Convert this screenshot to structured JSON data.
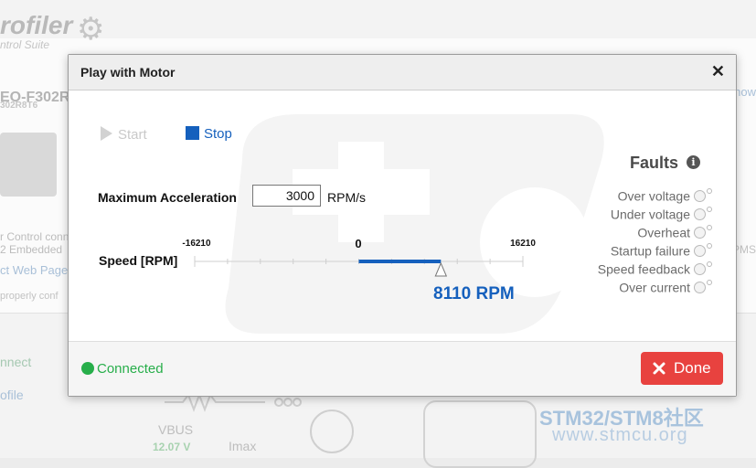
{
  "background": {
    "logo_main": "rofiler",
    "logo_sub": "ntrol Suite",
    "board_name": "EO-F302R",
    "board_part": "302R8T6",
    "text_line1": "r Control conn",
    "text_line2": "2 Embedded",
    "link_text": "ct Web Page",
    "text_line3": "properly conf",
    "right_link": "how",
    "right_text": "PMS",
    "nav_connect": "nnect",
    "nav_profile": "ofile",
    "vbus_label": "VBUS",
    "vbus_value": "12.07 V",
    "imax_label": "Imax",
    "watermark_line1": "STM32/STM8社区",
    "watermark_line2": "www.stmcu.org"
  },
  "dialog": {
    "title": "Play with Motor",
    "close_icon": "close-icon",
    "start_label": "Start",
    "stop_label": "Stop",
    "acceleration": {
      "label": "Maximum Acceleration",
      "value": "3000",
      "unit": "RPM/s"
    },
    "speed": {
      "label": "Speed [RPM]",
      "min_label": "-16210",
      "zero_label": "0",
      "max_label": "16210",
      "min": -16210,
      "max": 16210,
      "current": 8110,
      "value_text": "8110 RPM",
      "accent_color": "#1560bd"
    },
    "faults": {
      "title": "Faults",
      "items": [
        {
          "label": "Over voltage"
        },
        {
          "label": "Under voltage"
        },
        {
          "label": "Overheat"
        },
        {
          "label": "Startup failure"
        },
        {
          "label": "Speed feedback"
        },
        {
          "label": "Over current"
        }
      ]
    },
    "status": {
      "text": "Connected",
      "color": "#27ae4a"
    },
    "done_label": "Done",
    "done_color": "#e8423f"
  }
}
